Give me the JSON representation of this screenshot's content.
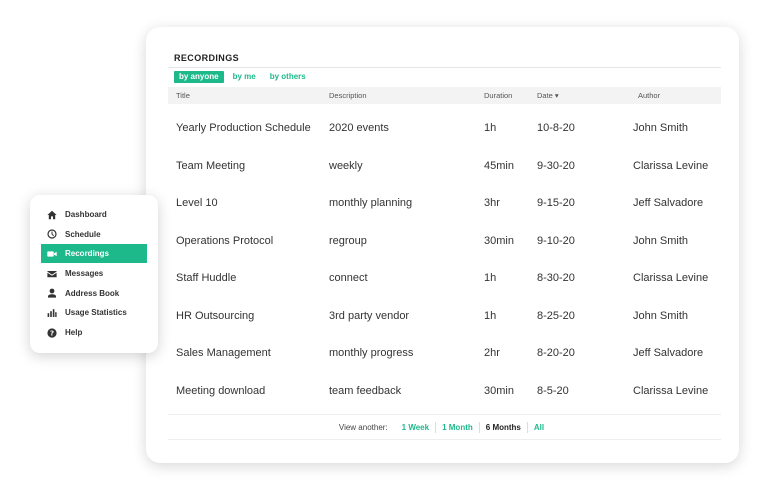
{
  "recordings": {
    "title": "RECORDINGS",
    "filters": [
      "by anyone",
      "by me",
      "by others"
    ],
    "active_filter": "by anyone",
    "columns": {
      "title": "Title",
      "description": "Description",
      "duration": "Duration",
      "date": "Date ▾",
      "author": "Author"
    },
    "rows": [
      {
        "title": "Yearly Production Schedule",
        "description": "2020 events",
        "duration": "1h",
        "date": "10-8-20",
        "author": "John Smith"
      },
      {
        "title": "Team Meeting",
        "description": "weekly",
        "duration": "45min",
        "date": "9-30-20",
        "author": "Clarissa Levine"
      },
      {
        "title": "Level 10",
        "description": "monthly planning",
        "duration": "3hr",
        "date": "9-15-20",
        "author": "Jeff Salvadore"
      },
      {
        "title": "Operations Protocol",
        "description": "regroup",
        "duration": "30min",
        "date": "9-10-20",
        "author": "John Smith"
      },
      {
        "title": "Staff Huddle",
        "description": "connect",
        "duration": "1h",
        "date": "8-30-20",
        "author": "Clarissa Levine"
      },
      {
        "title": "HR Outsourcing",
        "description": "3rd party vendor",
        "duration": "1h",
        "date": "8-25-20",
        "author": "John Smith"
      },
      {
        "title": "Sales Management",
        "description": "monthly progress",
        "duration": "2hr",
        "date": "8-20-20",
        "author": "Jeff Salvadore"
      },
      {
        "title": "Meeting download",
        "description": "team feedback",
        "duration": "30min",
        "date": "8-5-20",
        "author": "Clarissa Levine"
      }
    ],
    "footer": {
      "label": "View another:",
      "options": [
        "1 Week",
        "1 Month",
        "6 Months",
        "All"
      ],
      "current": "6 Months"
    }
  },
  "sidebar": {
    "items": [
      {
        "label": "Dashboard",
        "icon": "home-icon"
      },
      {
        "label": "Schedule",
        "icon": "clock-icon"
      },
      {
        "label": "Recordings",
        "icon": "video-camera-icon"
      },
      {
        "label": "Messages",
        "icon": "envelope-icon"
      },
      {
        "label": "Address Book",
        "icon": "user-icon"
      },
      {
        "label": "Usage Statistics",
        "icon": "bar-chart-icon"
      },
      {
        "label": "Help",
        "icon": "question-circle-icon"
      }
    ],
    "active": "Recordings"
  },
  "colors": {
    "accent": "#1db98b",
    "header_bg": "#f3f3f3"
  }
}
